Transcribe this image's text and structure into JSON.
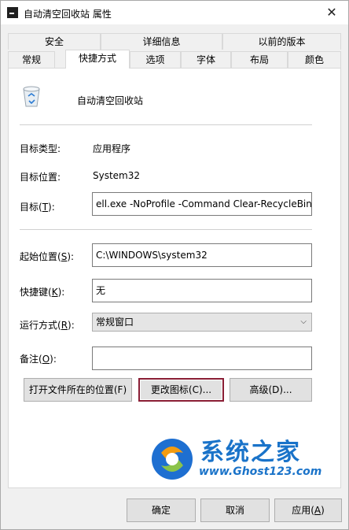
{
  "window": {
    "title": "自动清空回收站 属性",
    "close_icon": "close-icon"
  },
  "tabs_row1": [
    {
      "label": "安全"
    },
    {
      "label": "详细信息"
    },
    {
      "label": "以前的版本"
    }
  ],
  "tabs_row2": [
    {
      "label": "常规"
    },
    {
      "label": "快捷方式",
      "active": true
    },
    {
      "label": "选项"
    },
    {
      "label": "字体"
    },
    {
      "label": "布局"
    },
    {
      "label": "颜色"
    }
  ],
  "shortcut": {
    "name": "自动清空回收站",
    "target_type_label": "目标类型:",
    "target_type_value": "应用程序",
    "target_location_label": "目标位置:",
    "target_location_value": "System32",
    "target_label_text": "目标(",
    "target_label_key": "T",
    "target_label_end": "):",
    "target_value": "ell.exe -NoProfile -Command Clear-RecycleBin\"",
    "start_in_label_text": "起始位置(",
    "start_in_label_key": "S",
    "start_in_label_end": "):",
    "start_in_value": "C:\\WINDOWS\\system32",
    "hotkey_label_text": "快捷键(",
    "hotkey_label_key": "K",
    "hotkey_label_end": "):",
    "hotkey_value": "无",
    "run_label_text": "运行方式(",
    "run_label_key": "R",
    "run_label_end": "):",
    "run_value": "常规窗口",
    "comment_label_text": "备注(",
    "comment_label_key": "O",
    "comment_label_end": "):",
    "comment_value": "",
    "open_location_button": "打开文件所在的位置(F)",
    "change_icon_button": "更改图标(C)...",
    "advanced_button": "高级(D)..."
  },
  "footer": {
    "ok": "确定",
    "cancel": "取消",
    "apply_text": "应用(",
    "apply_key": "A",
    "apply_end": ")"
  },
  "watermark": {
    "title": "系统之家",
    "url": "www.Ghost123.com"
  },
  "colors": {
    "focus_border": "#8a1e35",
    "watermark_blue": "#1a73c9"
  }
}
